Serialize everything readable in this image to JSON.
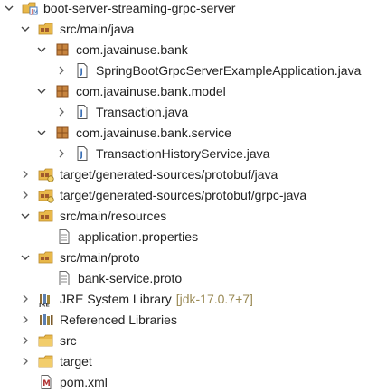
{
  "project": {
    "label": "boot-server-streaming-grpc-server",
    "expanded": true,
    "icon": "project-folder-icon"
  },
  "source_folders": [
    {
      "label": "src/main/java",
      "expanded": true,
      "packages": [
        {
          "label": "com.javainuse.bank",
          "expanded": true,
          "files": [
            {
              "label": "SpringBootGrpcServerExampleApplication.java",
              "icon": "java-file-icon"
            }
          ]
        },
        {
          "label": "com.javainuse.bank.model",
          "expanded": true,
          "files": [
            {
              "label": "Transaction.java",
              "icon": "java-file-icon"
            }
          ]
        },
        {
          "label": "com.javainuse.bank.service",
          "expanded": true,
          "files": [
            {
              "label": "TransactionHistoryService.java",
              "icon": "java-file-icon"
            }
          ]
        }
      ]
    },
    {
      "label": "target/generated-sources/protobuf/java",
      "expanded": false
    },
    {
      "label": "target/generated-sources/protobuf/grpc-java",
      "expanded": false
    },
    {
      "label": "src/main/resources",
      "expanded": true,
      "files": [
        {
          "label": "application.properties",
          "icon": "text-file-icon"
        }
      ]
    },
    {
      "label": "src/main/proto",
      "expanded": true,
      "files": [
        {
          "label": "bank-service.proto",
          "icon": "text-file-icon"
        }
      ]
    }
  ],
  "libraries": {
    "jre": {
      "label": "JRE System Library",
      "decoration": "[jdk-17.0.7+7]",
      "expanded": false
    },
    "referenced": {
      "label": "Referenced Libraries",
      "expanded": false
    }
  },
  "folders": [
    {
      "label": "src",
      "expanded": false
    },
    {
      "label": "target",
      "expanded": false
    }
  ],
  "pom": {
    "label": "pom.xml",
    "icon": "maven-xml-file-icon"
  },
  "colors": {
    "package_icon": "#a05a2c",
    "folder_icon": "#e8b84a",
    "java_file_blue": "#3a6fb5",
    "decoration_text": "#9a8a55",
    "label_text": "#222222"
  }
}
